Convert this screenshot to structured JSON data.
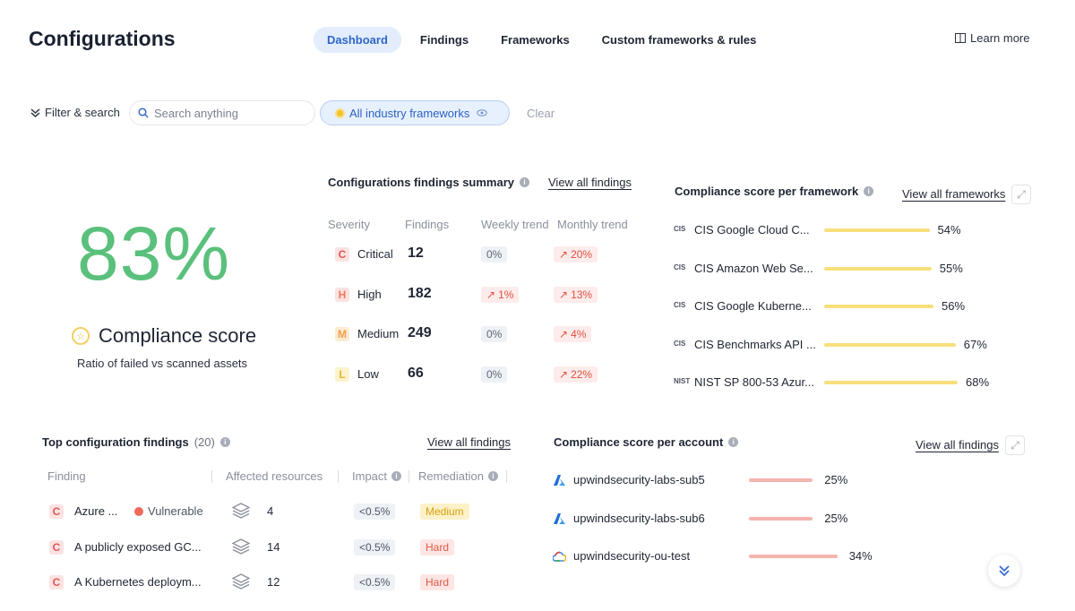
{
  "header": {
    "title": "Configurations",
    "tabs": [
      {
        "label": "Dashboard",
        "active": true
      },
      {
        "label": "Findings",
        "active": false
      },
      {
        "label": "Frameworks",
        "active": false
      },
      {
        "label": "Custom frameworks & rules",
        "active": false
      }
    ],
    "learn_more": "Learn more"
  },
  "filters": {
    "toggle_label": "Filter & search",
    "search_placeholder": "Search anything",
    "framework_chip": "All industry frameworks",
    "clear": "Clear"
  },
  "compliance": {
    "score": "83%",
    "label": "Compliance score",
    "subtitle": "Ratio of failed vs scanned assets"
  },
  "findings_summary": {
    "title": "Configurations findings summary",
    "view_all": "View all findings",
    "columns": [
      "Severity",
      "Findings",
      "Weekly trend",
      "Monthly trend"
    ],
    "rows": [
      {
        "letter": "C",
        "severity": "Critical",
        "count": "12",
        "weekly": "0%",
        "weekly_up": false,
        "monthly": "20%",
        "monthly_up": true
      },
      {
        "letter": "H",
        "severity": "High",
        "count": "182",
        "weekly": "1%",
        "weekly_up": true,
        "monthly": "13%",
        "monthly_up": true
      },
      {
        "letter": "M",
        "severity": "Medium",
        "count": "249",
        "weekly": "0%",
        "weekly_up": false,
        "monthly": "4%",
        "monthly_up": true
      },
      {
        "letter": "L",
        "severity": "Low",
        "count": "66",
        "weekly": "0%",
        "weekly_up": false,
        "monthly": "22%",
        "monthly_up": true
      }
    ]
  },
  "framework_scores": {
    "title": "Compliance score per framework",
    "view_all": "View all frameworks",
    "items": [
      {
        "icon": "CIS",
        "name": "CIS Google Cloud C...",
        "pct": "54%",
        "value": 54
      },
      {
        "icon": "CIS",
        "name": "CIS Amazon Web Se...",
        "pct": "55%",
        "value": 55
      },
      {
        "icon": "CIS",
        "name": "CIS Google Kuberne...",
        "pct": "56%",
        "value": 56
      },
      {
        "icon": "CIS",
        "name": "CIS Benchmarks API ...",
        "pct": "67%",
        "value": 67
      },
      {
        "icon": "NIST",
        "name": "NIST SP 800-53 Azur...",
        "pct": "68%",
        "value": 68
      }
    ]
  },
  "top_findings": {
    "title": "Top configuration findings",
    "count": "(20)",
    "view_all": "View all findings",
    "columns": [
      "Finding",
      "Affected resources",
      "Impact",
      "Remediation"
    ],
    "rows": [
      {
        "letter": "C",
        "name": "Azure ...",
        "badge": "Vulnerable",
        "resources": "4",
        "impact": "<0.5%",
        "remediation": "Medium",
        "level": "medium"
      },
      {
        "letter": "C",
        "name": "A publicly exposed GC...",
        "badge": "",
        "resources": "14",
        "impact": "<0.5%",
        "remediation": "Hard",
        "level": "hard"
      },
      {
        "letter": "C",
        "name": "A Kubernetes deploym...",
        "badge": "",
        "resources": "12",
        "impact": "<0.5%",
        "remediation": "Hard",
        "level": "hard"
      }
    ]
  },
  "account_scores": {
    "title": "Compliance score per account",
    "view_all": "View all findings",
    "items": [
      {
        "provider": "azure",
        "name": "upwindsecurity-labs-sub5",
        "pct": "25%",
        "value": 25
      },
      {
        "provider": "azure",
        "name": "upwindsecurity-labs-sub6",
        "pct": "25%",
        "value": 25
      },
      {
        "provider": "gcp",
        "name": "upwindsecurity-ou-test",
        "pct": "34%",
        "value": 34
      }
    ]
  },
  "colors": {
    "accent": "#2f66c9",
    "score_green": "#5ac07c",
    "bar_yellow": "#f8df7c",
    "bar_pink": "#f5b4ad"
  }
}
